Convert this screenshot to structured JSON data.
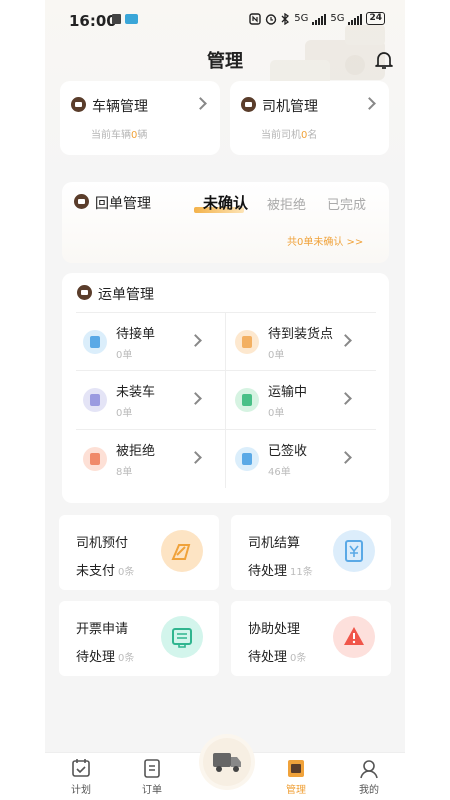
{
  "status": {
    "time": "16:00",
    "battery": "24",
    "sig1": "5G",
    "sig2": "5G"
  },
  "header": {
    "title": "管理"
  },
  "vehicle": {
    "title": "车辆管理",
    "prefix": "当前车辆",
    "count": "0",
    "suffix": "辆"
  },
  "driver": {
    "title": "司机管理",
    "prefix": "当前司机",
    "count": "0",
    "suffix": "名"
  },
  "receipt": {
    "title": "回单管理",
    "tabs": [
      "未确认",
      "被拒绝",
      "已完成"
    ],
    "link": "共0单未确认 >>"
  },
  "waybill": {
    "title": "运单管理",
    "items": [
      {
        "label": "待接单",
        "count": "0单"
      },
      {
        "label": "待到装货点",
        "count": "0单"
      },
      {
        "label": "未装车",
        "count": "0单"
      },
      {
        "label": "运输中",
        "count": "0单"
      },
      {
        "label": "被拒绝",
        "count": "8单"
      },
      {
        "label": "已签收",
        "count": "46单"
      }
    ]
  },
  "tiles": [
    {
      "title": "司机预付",
      "status": "未支付",
      "count": "0条"
    },
    {
      "title": "司机结算",
      "status": "待处理",
      "count": "11条"
    },
    {
      "title": "开票申请",
      "status": "待处理",
      "count": "0条"
    },
    {
      "title": "协助处理",
      "status": "待处理",
      "count": "0条"
    }
  ],
  "nav": {
    "items": [
      "计划",
      "订单",
      "管理",
      "我的"
    ]
  },
  "colors": {
    "accent": "#f0a23a",
    "brown": "#5a3d2b"
  }
}
